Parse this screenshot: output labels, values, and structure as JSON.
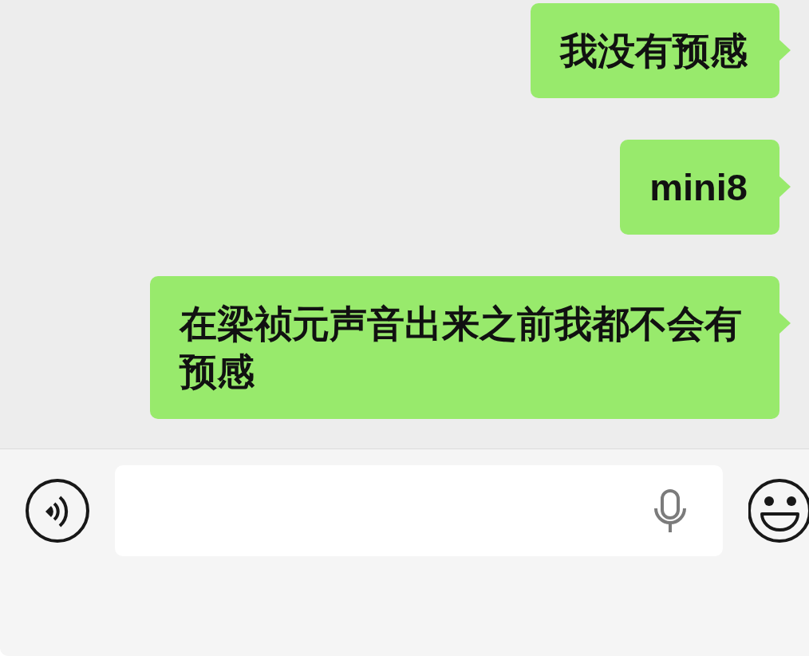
{
  "messages": [
    {
      "kind": "outgoing",
      "text": "我没有预感"
    },
    {
      "kind": "outgoing",
      "text": "mini8"
    },
    {
      "kind": "outgoing",
      "text": "在梁祯元声音出来之前我都不会有预感"
    }
  ]
}
